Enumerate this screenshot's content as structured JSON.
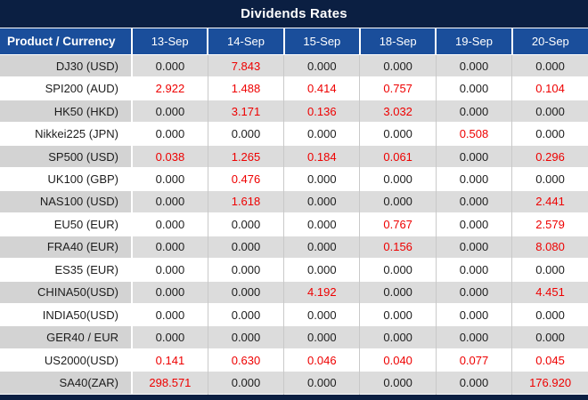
{
  "title": "Dividends Rates",
  "colors": {
    "title_bg": "#0b1f42",
    "header_bg": "#1a4e9b",
    "gray_row_bg": "#dcdcdc",
    "gray_label_bg": "#d3d3d3",
    "zero_value_text": "#1d1d1d",
    "nonzero_value_text": "#ee0000"
  },
  "table": {
    "product_header": "Product / Currency",
    "date_headers": [
      "13-Sep",
      "14-Sep",
      "15-Sep",
      "18-Sep",
      "19-Sep",
      "20-Sep"
    ],
    "rows": [
      {
        "product": "DJ30 (USD)",
        "values": [
          "0.000",
          "7.843",
          "0.000",
          "0.000",
          "0.000",
          "0.000"
        ]
      },
      {
        "product": "SPI200 (AUD)",
        "values": [
          "2.922",
          "1.488",
          "0.414",
          "0.757",
          "0.000",
          "0.104"
        ]
      },
      {
        "product": "HK50 (HKD)",
        "values": [
          "0.000",
          "3.171",
          "0.136",
          "3.032",
          "0.000",
          "0.000"
        ]
      },
      {
        "product": "Nikkei225 (JPN)",
        "values": [
          "0.000",
          "0.000",
          "0.000",
          "0.000",
          "0.508",
          "0.000"
        ]
      },
      {
        "product": "SP500 (USD)",
        "values": [
          "0.038",
          "1.265",
          "0.184",
          "0.061",
          "0.000",
          "0.296"
        ]
      },
      {
        "product": "UK100 (GBP)",
        "values": [
          "0.000",
          "0.476",
          "0.000",
          "0.000",
          "0.000",
          "0.000"
        ]
      },
      {
        "product": "NAS100 (USD)",
        "values": [
          "0.000",
          "1.618",
          "0.000",
          "0.000",
          "0.000",
          "2.441"
        ]
      },
      {
        "product": "EU50 (EUR)",
        "values": [
          "0.000",
          "0.000",
          "0.000",
          "0.767",
          "0.000",
          "2.579"
        ]
      },
      {
        "product": "FRA40 (EUR)",
        "values": [
          "0.000",
          "0.000",
          "0.000",
          "0.156",
          "0.000",
          "8.080"
        ]
      },
      {
        "product": "ES35 (EUR)",
        "values": [
          "0.000",
          "0.000",
          "0.000",
          "0.000",
          "0.000",
          "0.000"
        ]
      },
      {
        "product": "CHINA50(USD)",
        "values": [
          "0.000",
          "0.000",
          "4.192",
          "0.000",
          "0.000",
          "4.451"
        ]
      },
      {
        "product": "INDIA50(USD)",
        "values": [
          "0.000",
          "0.000",
          "0.000",
          "0.000",
          "0.000",
          "0.000"
        ]
      },
      {
        "product": "GER40 / EUR",
        "values": [
          "0.000",
          "0.000",
          "0.000",
          "0.000",
          "0.000",
          "0.000"
        ]
      },
      {
        "product": "US2000(USD)",
        "values": [
          "0.141",
          "0.630",
          "0.046",
          "0.040",
          "0.077",
          "0.045"
        ]
      },
      {
        "product": "SA40(ZAR)",
        "values": [
          "298.571",
          "0.000",
          "0.000",
          "0.000",
          "0.000",
          "176.920"
        ]
      }
    ]
  }
}
